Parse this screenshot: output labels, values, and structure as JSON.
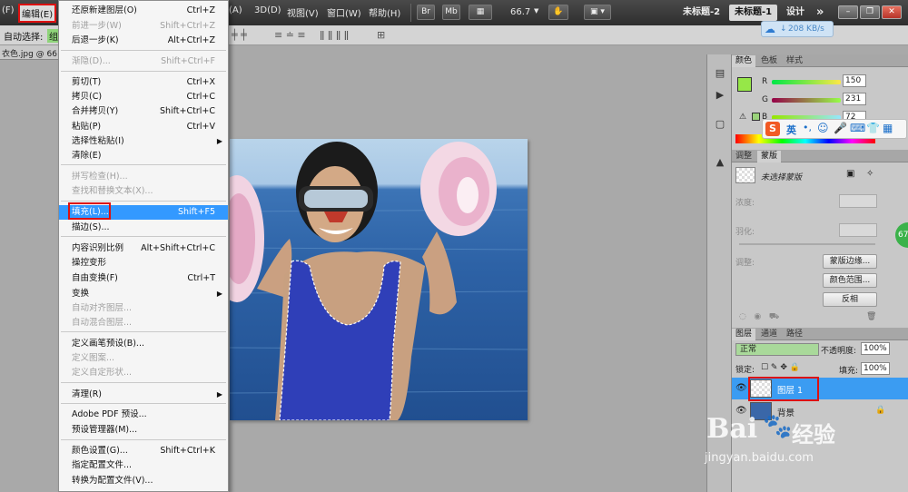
{
  "menubar": {
    "file_fragment": "(F)",
    "edit_menu": "编辑(E)",
    "three_d": "3D(D)",
    "view": "视图(V)",
    "window": "窗口(W)",
    "help": "帮助(H)",
    "bridge_btn": "Br",
    "minibridge_btn": "Mb",
    "zoom_value": "66.7",
    "tab_untitled2": "未标题-2",
    "tab_untitled1": "未标题-1",
    "workspace": "设计",
    "more": "»",
    "image_partial_menu": "(A)"
  },
  "options_bar": {
    "auto_select_label": "自动选择:",
    "auto_select_value": "组"
  },
  "doc_tab": "衣色.jpg @ 66",
  "network": {
    "speed": "208 KB/s"
  },
  "edit_menu": {
    "items": [
      {
        "label": "还原新建图层(O)",
        "shortcut": "Ctrl+Z",
        "disabled": false
      },
      {
        "label": "前进一步(W)",
        "shortcut": "Shift+Ctrl+Z",
        "disabled": true
      },
      {
        "label": "后退一步(K)",
        "shortcut": "Alt+Ctrl+Z",
        "disabled": false
      },
      {
        "label": "渐隐(D)...",
        "shortcut": "Shift+Ctrl+F",
        "disabled": true
      },
      {
        "label": "剪切(T)",
        "shortcut": "Ctrl+X",
        "disabled": false
      },
      {
        "label": "拷贝(C)",
        "shortcut": "Ctrl+C",
        "disabled": false
      },
      {
        "label": "合并拷贝(Y)",
        "shortcut": "Shift+Ctrl+C",
        "disabled": false
      },
      {
        "label": "粘贴(P)",
        "shortcut": "Ctrl+V",
        "disabled": false
      },
      {
        "label": "选择性粘贴(I)",
        "shortcut": "",
        "disabled": false,
        "submenu": true
      },
      {
        "label": "清除(E)",
        "shortcut": "",
        "disabled": false
      },
      {
        "label": "拼写检查(H)...",
        "shortcut": "",
        "disabled": true
      },
      {
        "label": "查找和替换文本(X)...",
        "shortcut": "",
        "disabled": true
      },
      {
        "label": "填充(L)...",
        "shortcut": "Shift+F5",
        "disabled": false,
        "highlighted": true
      },
      {
        "label": "描边(S)...",
        "shortcut": "",
        "disabled": false
      },
      {
        "label": "内容识别比例",
        "shortcut": "Alt+Shift+Ctrl+C",
        "disabled": false
      },
      {
        "label": "操控变形",
        "shortcut": "",
        "disabled": false
      },
      {
        "label": "自由变换(F)",
        "shortcut": "Ctrl+T",
        "disabled": false
      },
      {
        "label": "变换",
        "shortcut": "",
        "disabled": false,
        "submenu": true
      },
      {
        "label": "自动对齐图层...",
        "shortcut": "",
        "disabled": true
      },
      {
        "label": "自动混合图层...",
        "shortcut": "",
        "disabled": true
      },
      {
        "label": "定义画笔预设(B)...",
        "shortcut": "",
        "disabled": false
      },
      {
        "label": "定义图案...",
        "shortcut": "",
        "disabled": true
      },
      {
        "label": "定义自定形状...",
        "shortcut": "",
        "disabled": true
      },
      {
        "label": "清理(R)",
        "shortcut": "",
        "disabled": false,
        "submenu": true
      },
      {
        "label": "Adobe PDF 预设...",
        "shortcut": "",
        "disabled": false
      },
      {
        "label": "预设管理器(M)...",
        "shortcut": "",
        "disabled": false
      },
      {
        "label": "颜色设置(G)...",
        "shortcut": "Shift+Ctrl+K",
        "disabled": false
      },
      {
        "label": "指定配置文件...",
        "shortcut": "",
        "disabled": false
      },
      {
        "label": "转换为配置文件(V)...",
        "shortcut": "",
        "disabled": false
      }
    ]
  },
  "color_panel": {
    "tabs": [
      "颜色",
      "色板",
      "样式"
    ],
    "r_label": "R",
    "g_label": "G",
    "b_label": "B",
    "r": "150",
    "g": "231",
    "b": "72",
    "foreground_color": "#96e748"
  },
  "sogou": {
    "lang": "英"
  },
  "masks_panel": {
    "tabs": [
      "调整",
      "蒙版"
    ],
    "no_mask": "未选择蒙版",
    "density": "浓度:",
    "feather": "羽化:",
    "refine": "调整:",
    "mask_edge_btn": "蒙版边缘...",
    "color_range_btn": "颜色范围...",
    "invert_btn": "反相"
  },
  "layers_panel": {
    "tabs": [
      "图层",
      "通道",
      "路径"
    ],
    "blend_mode": "正常",
    "opacity_label": "不透明度:",
    "opacity_value": "100%",
    "lock_label": "锁定:",
    "fill_label": "填充:",
    "fill_value": "100%",
    "layers": [
      {
        "name": "图层 1",
        "selected": true
      },
      {
        "name": "背景",
        "selected": false
      }
    ]
  },
  "side_badge": "67",
  "watermark": {
    "brand": "Bai",
    "brand2": "经验",
    "url": "jingyan.baidu.com"
  }
}
